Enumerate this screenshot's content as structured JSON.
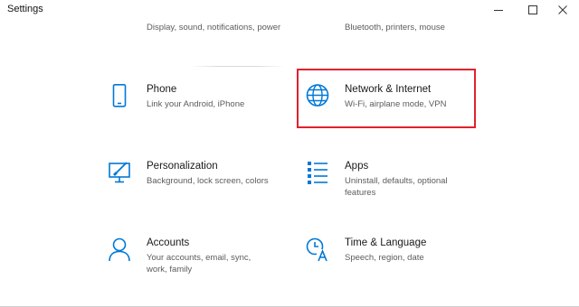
{
  "window": {
    "title": "Settings"
  },
  "controls": {
    "minimize_icon": "minimize-icon",
    "maximize_icon": "maximize-icon",
    "close_icon": "close-icon"
  },
  "accent_color": "#0078d7",
  "highlight_color": "#e0222e",
  "tiles": {
    "system": {
      "desc": "Display, sound, notifications, power",
      "icon": "monitor-icon"
    },
    "devices": {
      "desc": "Bluetooth, printers, mouse",
      "icon": "keyboard-icon"
    },
    "phone": {
      "name": "Phone",
      "desc": "Link your Android, iPhone",
      "icon": "phone-icon"
    },
    "network": {
      "name": "Network & Internet",
      "desc": "Wi-Fi, airplane mode, VPN",
      "icon": "globe-icon",
      "highlighted": true
    },
    "personalization": {
      "name": "Personalization",
      "desc": "Background, lock screen, colors",
      "icon": "paint-monitor-icon"
    },
    "apps": {
      "name": "Apps",
      "desc": "Uninstall, defaults, optional features",
      "icon": "apps-list-icon"
    },
    "accounts": {
      "name": "Accounts",
      "desc": "Your accounts, email, sync, work, family",
      "icon": "person-icon"
    },
    "time_language": {
      "name": "Time & Language",
      "desc": "Speech, region, date",
      "icon": "time-language-icon"
    }
  }
}
